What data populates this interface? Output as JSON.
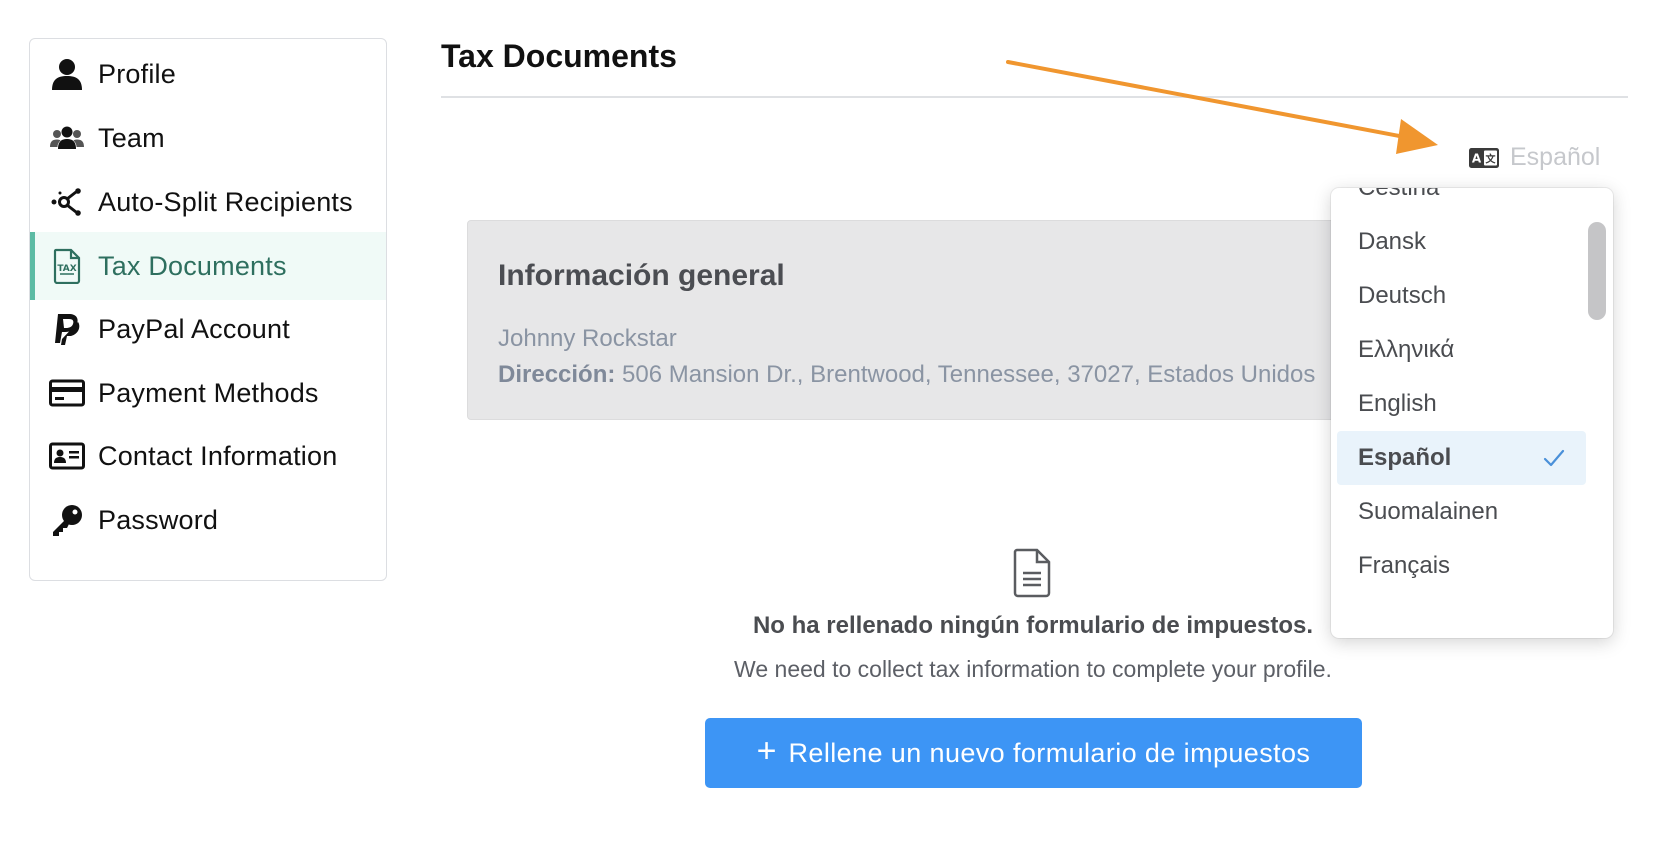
{
  "sidebar": {
    "items": [
      {
        "label": "Profile",
        "icon": "user-icon"
      },
      {
        "label": "Team",
        "icon": "users-icon"
      },
      {
        "label": "Auto-Split Recipients",
        "icon": "split-icon"
      },
      {
        "label": "Tax Documents",
        "icon": "tax-document-icon",
        "active": true
      },
      {
        "label": "PayPal Account",
        "icon": "paypal-icon"
      },
      {
        "label": "Payment Methods",
        "icon": "credit-card-icon"
      },
      {
        "label": "Contact Information",
        "icon": "id-card-icon"
      },
      {
        "label": "Password",
        "icon": "key-icon"
      }
    ]
  },
  "main": {
    "title": "Tax Documents",
    "language": {
      "icon": "translate-icon",
      "current": "Español"
    },
    "info_card": {
      "title": "Información general",
      "name": "Johnny Rockstar",
      "address_label": "Dirección:",
      "address_value": "506 Mansion Dr., Brentwood, Tennessee, 37027, Estados Unidos"
    },
    "empty_state": {
      "icon": "document-icon",
      "title": "No ha rellenado ningún formulario de impuestos.",
      "subtitle": "We need to collect tax information to complete your profile."
    },
    "cta": {
      "label": "Rellene un nuevo formulario de impuestos",
      "icon": "plus-icon"
    }
  },
  "language_dropdown": {
    "options": [
      "Čeština",
      "Dansk",
      "Deutsch",
      "Ελληνικά",
      "English",
      "Español",
      "Suomalainen",
      "Français"
    ],
    "selected": "Español"
  },
  "colors": {
    "accent_green": "#5cbba4",
    "cta_blue": "#3d95f5",
    "arrow_orange": "#f0962f",
    "selected_bg": "#e9f3fb"
  }
}
